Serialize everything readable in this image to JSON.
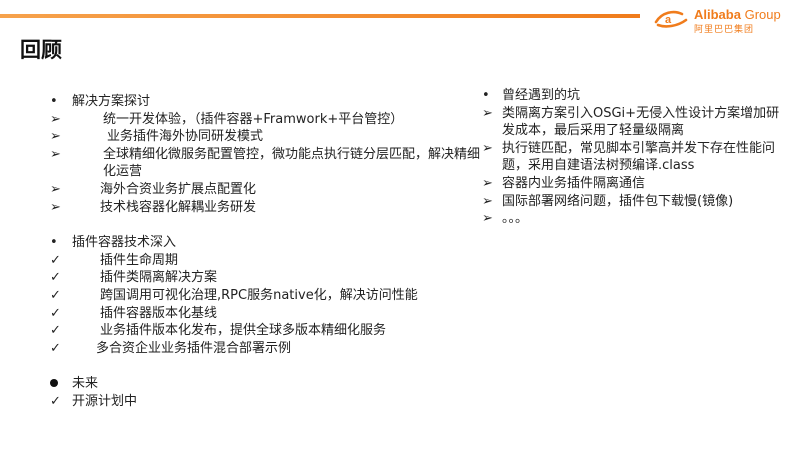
{
  "header": {
    "logo_text": "Alibaba",
    "logo_group": "Group",
    "logo_cn": "阿里巴巴集团",
    "accent": "#f07c1c"
  },
  "page_title": "回顾",
  "left": {
    "section1": {
      "heading": "解决方案探讨",
      "items": [
        "统一开发体验，（插件容器+Framwork+平台管控）",
        "业务插件海外协同研发模式",
        "全球精细化微服务配置管控，微功能点执行链分层匹配，解决精细化运营",
        "海外合资业务扩展点配置化",
        "技术栈容器化解耦业务研发"
      ]
    },
    "section2": {
      "heading": "插件容器技术深入",
      "items": [
        "插件生命周期",
        "插件类隔离解决方案",
        "跨国调用可视化治理,RPC服务native化，解决访问性能",
        "插件容器版本化基线",
        "业务插件版本化发布，提供全球多版本精细化服务",
        "多合资企业业务插件混合部署示例"
      ]
    },
    "section3": {
      "heading": "未来",
      "items": [
        "开源计划中"
      ]
    }
  },
  "right": {
    "heading": "曾经遇到的坑",
    "items": [
      "类隔离方案引入OSGi+无侵入性设计方案增加研发成本，最后采用了轻量级隔离",
      "执行链匹配，常见脚本引擎高并发下存在性能问题，采用自建语法树预编译.class",
      "容器内业务插件隔离通信",
      "国际部署网络问题，插件包下载慢(镜像)",
      "。。。"
    ]
  },
  "markers": {
    "bullet": "•",
    "arrow": "➢",
    "check": "✓"
  }
}
